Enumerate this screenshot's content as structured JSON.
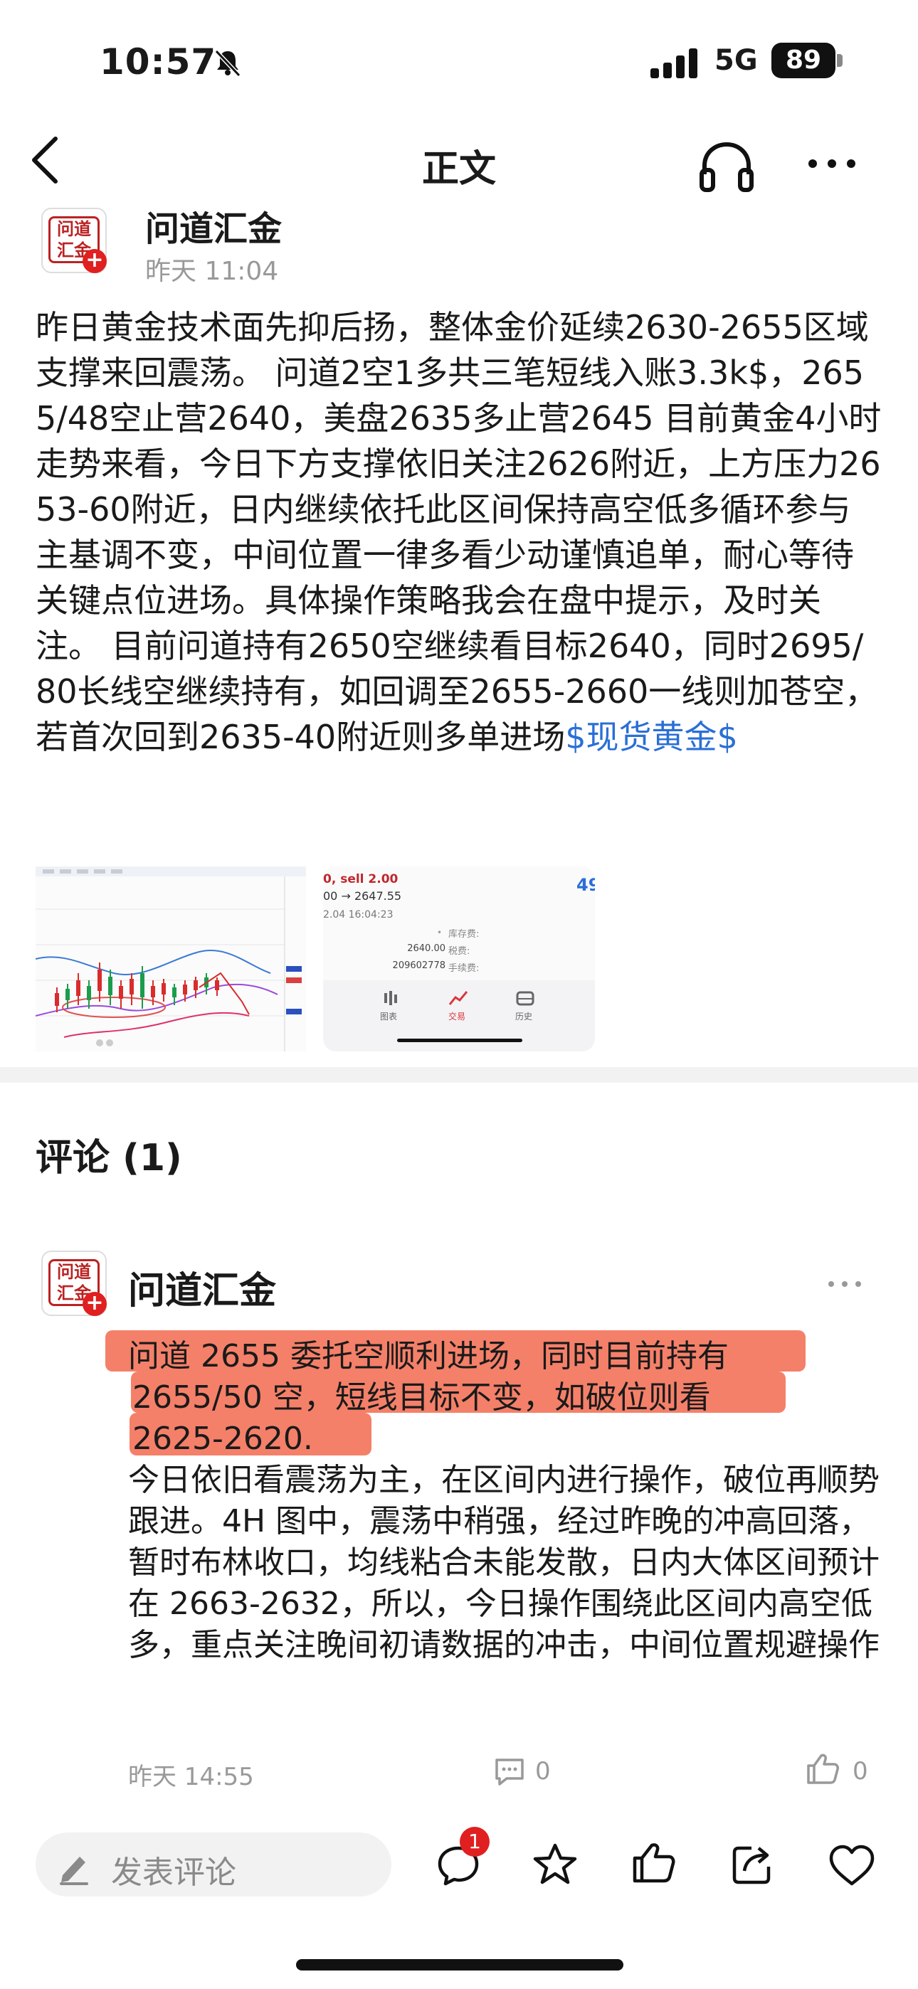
{
  "status_bar": {
    "time": "10:57",
    "network": "5G",
    "battery": "89"
  },
  "nav": {
    "title": "正文"
  },
  "author": {
    "name": "问道汇金",
    "time": "昨天 11:04",
    "avatar_text": "问道\n汇金"
  },
  "article": {
    "body": "昨日黄金技术面先抑后扬，整体金价延续2630-2655区域支撑来回震荡。 问道2空1多共三笔短线入账3.3k$，2655/48空止营2640，美盘2635多止营2645 目前黄金4小时走势来看，今日下方支撑依旧关注2626附近，上方压力2653-60附近，日内继续依托此区间保持高空低多循环参与主基调不变，中间位置一律多看少动谨慎追单，耐心等待关键点位进场。具体操作策略我会在盘中提示，及时关注。 目前问道持有2650空继续看目标2640，同时2695/80长线空继续持有，如回调至2655-2660一线则加苍空，若首次回到2635-40附近则多单进场",
    "tag": "$现货黄金$"
  },
  "thumb2": {
    "sell_line": "0, sell 2.00",
    "price_line": "00 → 2647.55",
    "date_line": "2.04 16:04:23",
    "number": "49",
    "rows": [
      {
        "value": "",
        "label": "库存费:"
      },
      {
        "value": "2640.00",
        "label": "税费:"
      },
      {
        "value": "209602778",
        "label": "手续费:"
      }
    ],
    "tabs": [
      "图表",
      "交易",
      "历史"
    ]
  },
  "comments": {
    "title": "评论 (1)",
    "items": [
      {
        "name": "问道汇金",
        "highlight_lines": [
          "问道 2655 委托空顺利进场，同时目前持有",
          "2655/50 空，短线目标不变，如破位则看",
          "2625-2620."
        ],
        "body": "今日依旧看震荡为主，在区间内进行操作，破位再顺势跟进。4H 图中，震荡中稍强，经过昨晚的冲高回落，暂时布林收口，均线粘合未能发散，日内大体区间预计在 2663-2632，所以，今日操作围绕此区间内高空低多，重点关注晚间初请数据的冲击，中间位置规避操作",
        "time": "昨天 14:55",
        "reply_count": "0",
        "like_count": "0"
      }
    ]
  },
  "bottom_bar": {
    "input_placeholder": "发表评论",
    "comment_badge": "1"
  },
  "colors": {
    "link": "#2a6fd6",
    "highlight": "#f26a4f",
    "badge": "#e02020",
    "muted": "#999999"
  }
}
